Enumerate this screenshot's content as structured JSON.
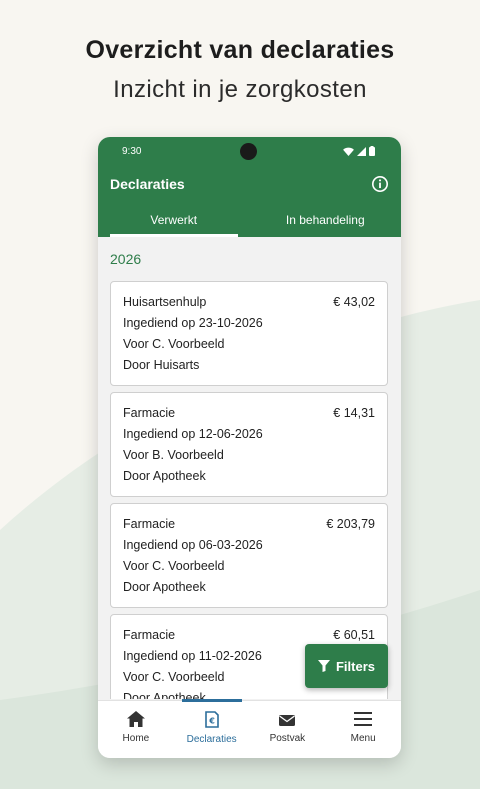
{
  "promo": {
    "headline": "Overzicht van declaraties",
    "subline": "Inzicht in je zorgkosten"
  },
  "status_bar": {
    "time": "9:30",
    "icons": [
      "wifi-icon",
      "signal-icon",
      "battery-icon"
    ]
  },
  "app_bar": {
    "title": "Declaraties",
    "info_icon": "info-icon"
  },
  "tabs": [
    {
      "label": "Verwerkt",
      "active": true
    },
    {
      "label": "In behandeling",
      "active": false
    }
  ],
  "year_header": "2026",
  "claims": [
    {
      "title": "Huisartsenhulp",
      "amount": "€ 43,02",
      "submitted": "Ingediend op 23-10-2026",
      "for": "Voor C. Voorbeeld",
      "by": "Door Huisarts"
    },
    {
      "title": "Farmacie",
      "amount": "€ 14,31",
      "submitted": "Ingediend op 12-06-2026",
      "for": "Voor B. Voorbeeld",
      "by": "Door Apotheek"
    },
    {
      "title": "Farmacie",
      "amount": "€ 203,79",
      "submitted": "Ingediend op 06-03-2026",
      "for": "Voor C. Voorbeeld",
      "by": "Door Apotheek"
    },
    {
      "title": "Farmacie",
      "amount": "€ 60,51",
      "submitted": "Ingediend op 11-02-2026",
      "for": "Voor C. Voorbeeld",
      "by": "Door Apotheek"
    }
  ],
  "filters_button": {
    "label": "Filters",
    "icon": "filter-icon"
  },
  "bottom_nav": [
    {
      "label": "Home",
      "icon": "home-icon",
      "active": false
    },
    {
      "label": "Declaraties",
      "icon": "receipt-euro-icon",
      "active": true
    },
    {
      "label": "Postvak",
      "icon": "mail-icon",
      "active": false
    },
    {
      "label": "Menu",
      "icon": "menu-icon",
      "active": false
    }
  ],
  "colors": {
    "primary_green": "#2e7d4a",
    "active_nav_blue": "#2c6e9b",
    "background": "#f8f6f1",
    "wave": "#e4ece4"
  }
}
